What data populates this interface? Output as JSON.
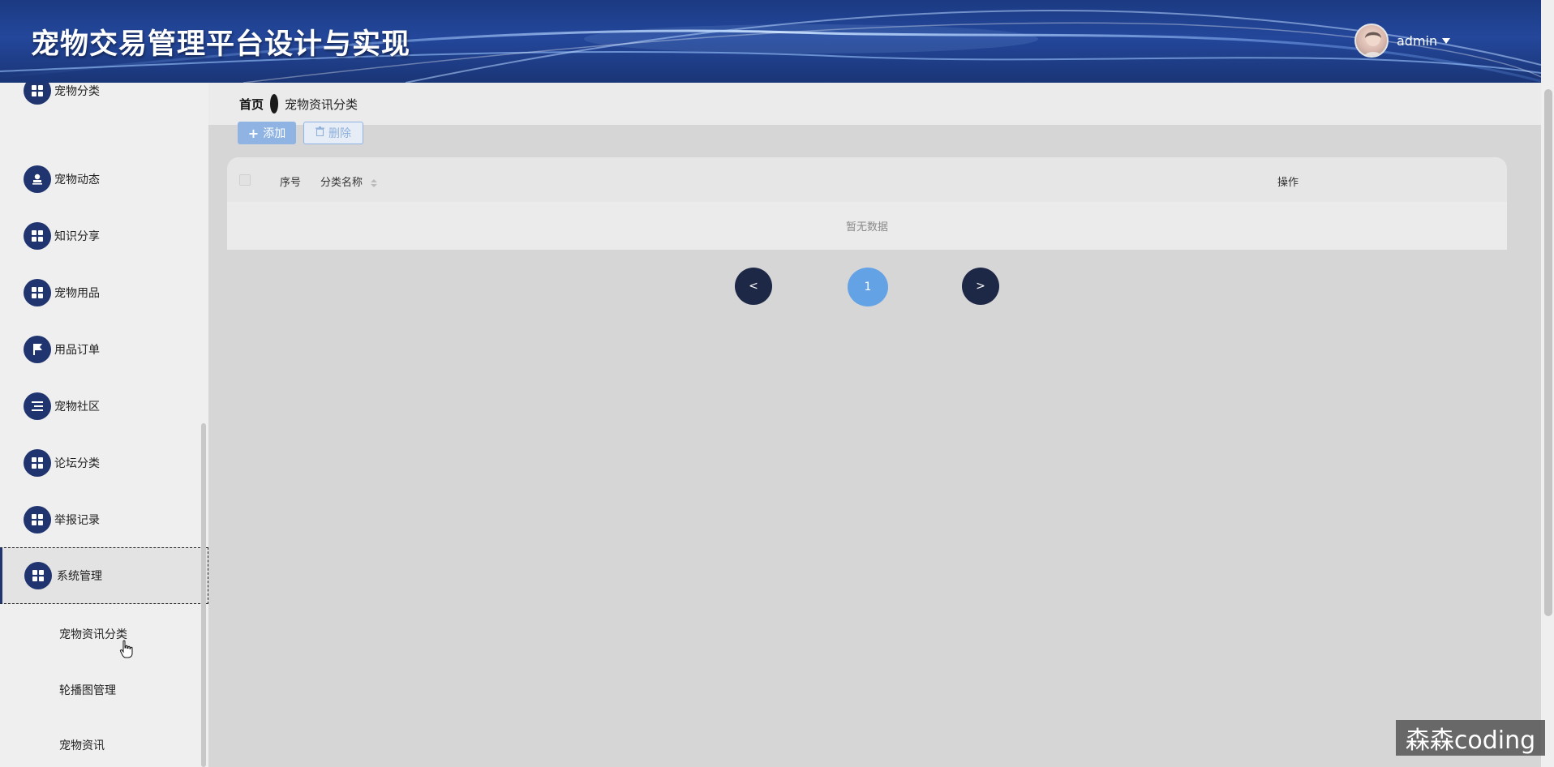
{
  "header": {
    "app_title": "宠物交易管理平台设计与实现",
    "username": "admin"
  },
  "breadcrumb": {
    "home": "首页",
    "current": "宠物资讯分类"
  },
  "sidebar": {
    "partial_item_label": "宠物分类",
    "items": [
      {
        "label": "宠物动态",
        "icon": "user-stamp-icon"
      },
      {
        "label": "知识分享",
        "icon": "grid-icon"
      },
      {
        "label": "宠物用品",
        "icon": "grid-icon"
      },
      {
        "label": "用品订单",
        "icon": "flag-icon"
      },
      {
        "label": "宠物社区",
        "icon": "list-icon"
      },
      {
        "label": "论坛分类",
        "icon": "grid-icon"
      },
      {
        "label": "举报记录",
        "icon": "grid-icon"
      },
      {
        "label": "系统管理",
        "icon": "grid-icon",
        "active": true
      }
    ],
    "sub_items": [
      {
        "label": "宠物资讯分类"
      },
      {
        "label": "轮播图管理"
      },
      {
        "label": "宠物资讯"
      }
    ]
  },
  "actions": {
    "add_label": "添加",
    "delete_label": "删除"
  },
  "table": {
    "columns": [
      "序号",
      "分类名称",
      "操作"
    ],
    "empty_text": "暂无数据"
  },
  "pagination": {
    "prev": "<",
    "current_page": "1",
    "next": ">"
  },
  "watermark": "森森coding",
  "colors": {
    "header_bg": "#24479b",
    "icon_bg": "#20356f",
    "primary": "#64a2e6",
    "pager_dark": "#1d2746"
  }
}
